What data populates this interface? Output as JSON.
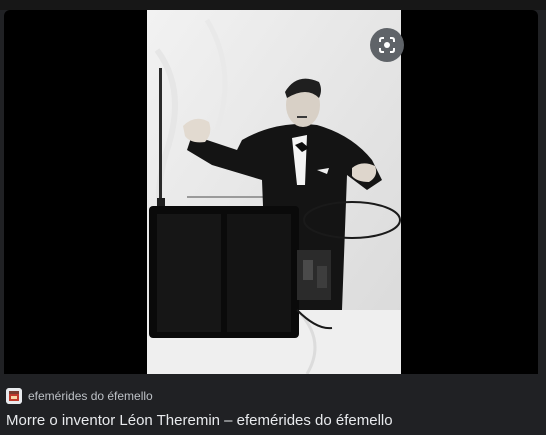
{
  "result": {
    "source_name": "efemérides do éfemello",
    "title": "Morre o inventor Léon Theremin – efemérides do éfemello",
    "lens_icon": "lens-icon",
    "favicon_icon": "site-favicon-icon"
  },
  "colors": {
    "background": "#202124",
    "image_background": "#000000",
    "title_text": "#e8eaed",
    "source_text": "#bdc1c6",
    "lens_button": "#5f6368"
  }
}
